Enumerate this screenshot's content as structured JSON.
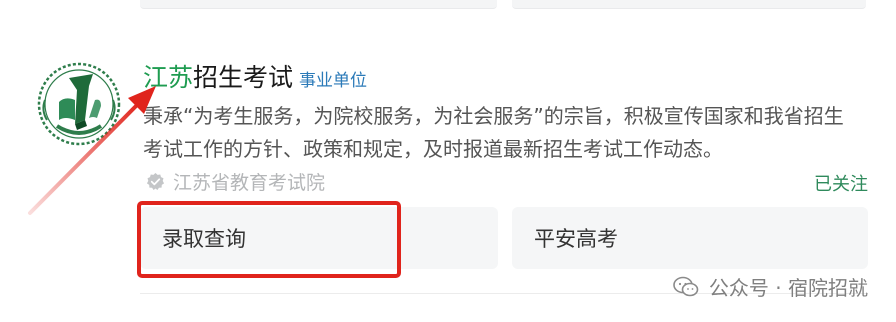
{
  "account": {
    "name_accent": "江苏",
    "name_rest": "招生考试",
    "badge": "事业单位",
    "description": "秉承“为考生服务，为院校服务，为社会服务”的宗旨，积极宣传国家和我省招生考试工作的方针、政策和规定，及时报道最新招生考试工作动态。",
    "verified_org": "江苏省教育考试院",
    "follow_status": "已关注"
  },
  "actions": [
    {
      "label": "录取查询"
    },
    {
      "label": "平安高考"
    }
  ],
  "watermark": {
    "text": "公众号 · 宿院招就"
  },
  "colors": {
    "accent_green": "#1f9c51",
    "badge_blue": "#2b7ab8",
    "follow_green": "#2f8a5c",
    "annotation_red": "#e0241c"
  },
  "icons": {
    "logo": "jiangsu-exam-emblem",
    "verified": "verified-check-icon",
    "watermark": "wechat-icon"
  }
}
